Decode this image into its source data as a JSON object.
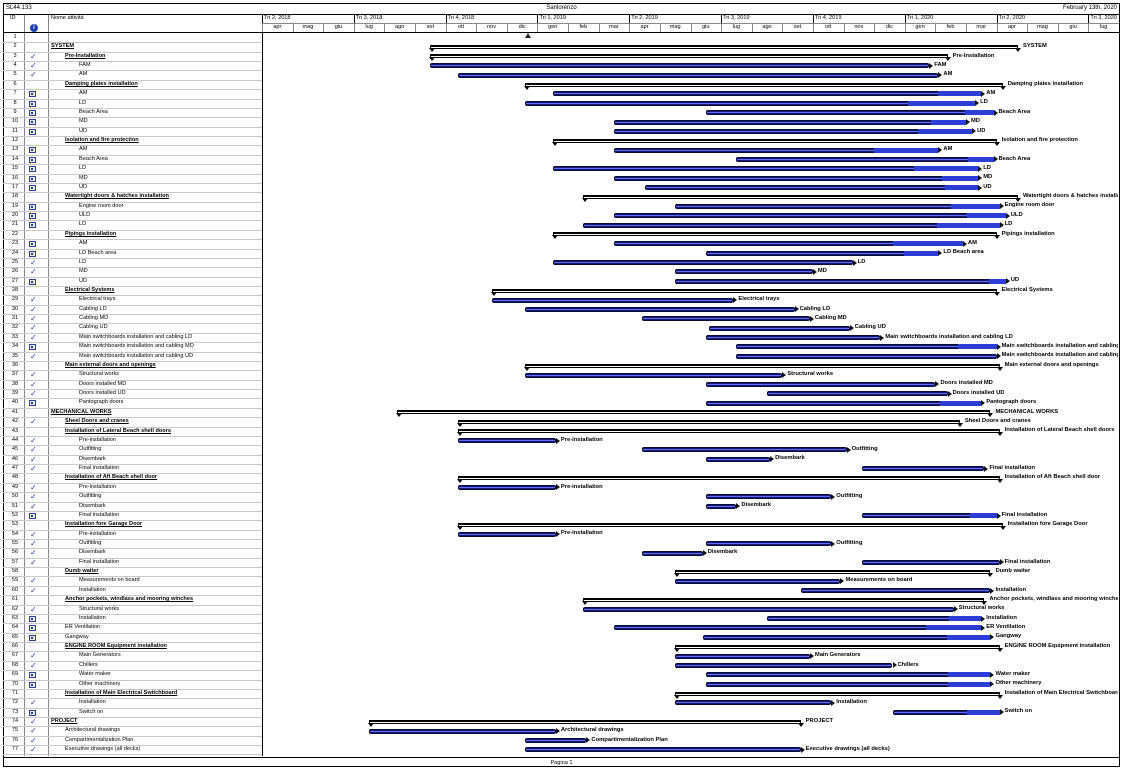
{
  "header": {
    "project_code": "SL44.133",
    "project_name": "Sanlorenzo",
    "date": "February 13th, 2020"
  },
  "columns": {
    "id": "ID",
    "info_icon": "info-icon",
    "name": "Nome attività"
  },
  "timescale": {
    "quarters": [
      "Tri 2, 2018",
      "Tri 3, 2018",
      "Tri 4, 2018",
      "Tri 1, 2019",
      "Tri 2, 2019",
      "Tri 3, 2019",
      "Tri 4, 2019",
      "Tri 1, 2020",
      "Tri 2, 2020",
      "Tri 3, 2020"
    ],
    "months": [
      "apr",
      "mag",
      "giu",
      "lug",
      "ago",
      "set",
      "ott",
      "nov",
      "dic",
      "gen",
      "feb",
      "mar",
      "apr",
      "mag",
      "giu",
      "lug",
      "ago",
      "set",
      "ott",
      "nov",
      "dic",
      "gen",
      "feb",
      "mar",
      "apr",
      "mag",
      "giu",
      "lug"
    ]
  },
  "colors": {
    "progress": "#2b3fd4",
    "summary": "#000000",
    "task": "#1a1a6e",
    "check": "#1f3fa8"
  },
  "tasks": [
    {
      "id": "1",
      "name": "",
      "level": 0,
      "summary": false,
      "ind": "",
      "start": null,
      "end": null,
      "pct": 0,
      "label": ""
    },
    {
      "id": "2",
      "name": "SYSTEM",
      "level": 0,
      "summary": true,
      "ind": "",
      "start": 5.5,
      "end": 24.7,
      "pct": 0,
      "label": "SYSTEM"
    },
    {
      "id": "3",
      "name": "Pre-Installation",
      "level": 1,
      "summary": true,
      "ind": "check",
      "start": 5.5,
      "end": 22.4,
      "pct": 0,
      "label": "Pre-Installation"
    },
    {
      "id": "4",
      "name": "FAM",
      "level": 2,
      "summary": false,
      "ind": "check",
      "start": 5.5,
      "end": 21.8,
      "pct": 0,
      "label": "FAM"
    },
    {
      "id": "5",
      "name": "AM",
      "level": 2,
      "summary": false,
      "ind": "check",
      "start": 6.4,
      "end": 22.1,
      "pct": 0,
      "label": "AM"
    },
    {
      "id": "6",
      "name": "Damping plates installation",
      "level": 1,
      "summary": true,
      "ind": "",
      "start": 8.6,
      "end": 24.2,
      "pct": 0,
      "label": "Damping plates installation"
    },
    {
      "id": "7",
      "name": "AM",
      "level": 2,
      "summary": false,
      "ind": "gantt",
      "start": 9.5,
      "end": 23.5,
      "pct": 0.9,
      "label": "AM"
    },
    {
      "id": "8",
      "name": "LD",
      "level": 2,
      "summary": false,
      "ind": "gantt",
      "start": 8.6,
      "end": 23.3,
      "pct": 0.85,
      "label": "LD"
    },
    {
      "id": "9",
      "name": "Beach Area",
      "level": 2,
      "summary": false,
      "ind": "gantt",
      "start": 14.5,
      "end": 23.9,
      "pct": 0.9,
      "label": "Beach Area"
    },
    {
      "id": "10",
      "name": "MD",
      "level": 2,
      "summary": false,
      "ind": "gantt",
      "start": 11.5,
      "end": 23.0,
      "pct": 0.9,
      "label": "MD"
    },
    {
      "id": "11",
      "name": "UD",
      "level": 2,
      "summary": false,
      "ind": "gantt",
      "start": 11.5,
      "end": 23.2,
      "pct": 0.85,
      "label": "UD"
    },
    {
      "id": "12",
      "name": "Isolation and fire protection",
      "level": 1,
      "summary": true,
      "ind": "",
      "start": 9.5,
      "end": 24.0,
      "pct": 0,
      "label": "Isolation and fire protection"
    },
    {
      "id": "13",
      "name": "AM",
      "level": 2,
      "summary": false,
      "ind": "gantt",
      "start": 11.5,
      "end": 22.1,
      "pct": 0.8,
      "label": "AM"
    },
    {
      "id": "14",
      "name": "Beach Area",
      "level": 2,
      "summary": false,
      "ind": "gantt",
      "start": 15.5,
      "end": 23.9,
      "pct": 0.9,
      "label": "Beach Area"
    },
    {
      "id": "15",
      "name": "LD",
      "level": 2,
      "summary": false,
      "ind": "gantt",
      "start": 9.5,
      "end": 23.4,
      "pct": 0.85,
      "label": "LD"
    },
    {
      "id": "16",
      "name": "MD",
      "level": 2,
      "summary": false,
      "ind": "gantt",
      "start": 11.5,
      "end": 23.4,
      "pct": 0.9,
      "label": "MD"
    },
    {
      "id": "17",
      "name": "UD",
      "level": 2,
      "summary": false,
      "ind": "gantt",
      "start": 12.5,
      "end": 23.4,
      "pct": 0.9,
      "label": "UD"
    },
    {
      "id": "18",
      "name": "Watertight doors & hatches installation",
      "level": 1,
      "summary": true,
      "ind": "",
      "start": 10.5,
      "end": 24.7,
      "pct": 0,
      "label": "Watertight doors & hatches installat"
    },
    {
      "id": "19",
      "name": "Engine room door",
      "level": 2,
      "summary": false,
      "ind": "gantt",
      "start": 13.5,
      "end": 24.1,
      "pct": 0.85,
      "label": "Engine room door"
    },
    {
      "id": "20",
      "name": "ULD",
      "level": 2,
      "summary": false,
      "ind": "gantt",
      "start": 11.5,
      "end": 24.3,
      "pct": 0.9,
      "label": "ULD"
    },
    {
      "id": "21",
      "name": "LD",
      "level": 2,
      "summary": false,
      "ind": "gantt",
      "start": 10.5,
      "end": 24.1,
      "pct": 0.85,
      "label": "LD"
    },
    {
      "id": "22",
      "name": "Pipings installation",
      "level": 1,
      "summary": true,
      "ind": "",
      "start": 9.5,
      "end": 24.0,
      "pct": 0,
      "label": "Pipings installation"
    },
    {
      "id": "23",
      "name": "AM",
      "level": 2,
      "summary": false,
      "ind": "gantt",
      "start": 11.5,
      "end": 22.9,
      "pct": 0.8,
      "label": "AM"
    },
    {
      "id": "24",
      "name": "LD Beach area",
      "level": 2,
      "summary": false,
      "ind": "gantt",
      "start": 14.5,
      "end": 22.1,
      "pct": 0.85,
      "label": "LD Beach area"
    },
    {
      "id": "25",
      "name": "LD",
      "level": 2,
      "summary": false,
      "ind": "check",
      "start": 9.5,
      "end": 19.3,
      "pct": 0,
      "label": "LD"
    },
    {
      "id": "26",
      "name": "MD",
      "level": 2,
      "summary": false,
      "ind": "check",
      "start": 13.5,
      "end": 18.0,
      "pct": 0,
      "label": "MD"
    },
    {
      "id": "27",
      "name": "UD",
      "level": 2,
      "summary": false,
      "ind": "gantt",
      "start": 13.5,
      "end": 24.3,
      "pct": 0.95,
      "label": "UD"
    },
    {
      "id": "28",
      "name": "Electrical Systems",
      "level": 1,
      "summary": true,
      "ind": "",
      "start": 7.5,
      "end": 24.0,
      "pct": 0,
      "label": "Electrical Systems"
    },
    {
      "id": "29",
      "name": "Electrical trays",
      "level": 2,
      "summary": false,
      "ind": "check",
      "start": 7.5,
      "end": 15.4,
      "pct": 0,
      "label": "Electrical trays"
    },
    {
      "id": "30",
      "name": "Cabling LD",
      "level": 2,
      "summary": false,
      "ind": "check",
      "start": 8.6,
      "end": 17.4,
      "pct": 0,
      "label": "Cabling LD"
    },
    {
      "id": "31",
      "name": "Cabling MD",
      "level": 2,
      "summary": false,
      "ind": "check",
      "start": 12.4,
      "end": 17.9,
      "pct": 0,
      "label": "Cabling MD"
    },
    {
      "id": "32",
      "name": "Cabling UD",
      "level": 2,
      "summary": false,
      "ind": "check",
      "start": 14.6,
      "end": 19.2,
      "pct": 0,
      "label": "Cabling UD"
    },
    {
      "id": "33",
      "name": "Main switchboards installation and cabling LD",
      "level": 2,
      "summary": false,
      "ind": "check",
      "start": 14.5,
      "end": 20.2,
      "pct": 0,
      "label": "Main switchboards installation and cabling LD"
    },
    {
      "id": "34",
      "name": "Main switchboards installation and cabling MD",
      "level": 2,
      "summary": false,
      "ind": "gantt",
      "start": 15.5,
      "end": 24.0,
      "pct": 0.85,
      "label": "Main switchboards installation and cabling MD"
    },
    {
      "id": "35",
      "name": "Main switchboards installation and cabling UD",
      "level": 2,
      "summary": false,
      "ind": "check",
      "start": 15.5,
      "end": 24.0,
      "pct": 0,
      "label": "Main switchboards installation and cabling"
    },
    {
      "id": "36",
      "name": "Main external doors and openings",
      "level": 1,
      "summary": true,
      "ind": "",
      "start": 8.6,
      "end": 24.1,
      "pct": 0,
      "label": "Main external doors and openings"
    },
    {
      "id": "37",
      "name": "Structural works",
      "level": 2,
      "summary": false,
      "ind": "check",
      "start": 8.6,
      "end": 17.0,
      "pct": 0,
      "label": "Structural works"
    },
    {
      "id": "38",
      "name": "Doors installed MD",
      "level": 2,
      "summary": false,
      "ind": "check",
      "start": 14.5,
      "end": 22.0,
      "pct": 0,
      "label": "Doors installed MD"
    },
    {
      "id": "39",
      "name": "Doors installed UD",
      "level": 2,
      "summary": false,
      "ind": "check",
      "start": 16.5,
      "end": 22.4,
      "pct": 0,
      "label": "Doors installed UD"
    },
    {
      "id": "40",
      "name": "Pantograph doors",
      "level": 2,
      "summary": false,
      "ind": "gantt",
      "start": 14.5,
      "end": 23.5,
      "pct": 0.85,
      "label": "Pantograph doors"
    },
    {
      "id": "41",
      "name": "MECHANICAL WORKS",
      "level": 0,
      "summary": true,
      "ind": "",
      "start": 4.4,
      "end": 23.8,
      "pct": 0,
      "label": "MECHANICAL WORKS"
    },
    {
      "id": "42",
      "name": "Sheel Doors and cranes",
      "level": 1,
      "summary": true,
      "ind": "check",
      "start": 6.4,
      "end": 22.8,
      "pct": 0,
      "label": "Sheel Doors and cranes"
    },
    {
      "id": "43",
      "name": "Installation of Lateral Beach shell doors",
      "level": 1,
      "summary": true,
      "ind": "",
      "start": 6.4,
      "end": 24.1,
      "pct": 0,
      "label": "Installation of Lateral Beach shell doors"
    },
    {
      "id": "44",
      "name": "Pre-installation",
      "level": 2,
      "summary": false,
      "ind": "check",
      "start": 6.4,
      "end": 9.6,
      "pct": 0,
      "label": "Pre-installation"
    },
    {
      "id": "45",
      "name": "Outfitting",
      "level": 2,
      "summary": false,
      "ind": "check",
      "start": 12.4,
      "end": 19.1,
      "pct": 0,
      "label": "Outfitting"
    },
    {
      "id": "46",
      "name": "Disembark",
      "level": 2,
      "summary": false,
      "ind": "check",
      "start": 14.5,
      "end": 16.6,
      "pct": 0,
      "label": "Disembark"
    },
    {
      "id": "47",
      "name": "Final installation",
      "level": 2,
      "summary": false,
      "ind": "check",
      "start": 19.6,
      "end": 23.6,
      "pct": 0,
      "label": "Final installation"
    },
    {
      "id": "48",
      "name": "Installation of Aft Beach shell door",
      "level": 1,
      "summary": true,
      "ind": "",
      "start": 6.4,
      "end": 24.1,
      "pct": 0,
      "label": "Installation of Aft Beach shell door"
    },
    {
      "id": "49",
      "name": "Pre-installation",
      "level": 2,
      "summary": false,
      "ind": "check",
      "start": 6.4,
      "end": 9.6,
      "pct": 0,
      "label": "Pre-installation"
    },
    {
      "id": "50",
      "name": "Outfitting",
      "level": 2,
      "summary": false,
      "ind": "check",
      "start": 14.5,
      "end": 18.6,
      "pct": 0,
      "label": "Outfitting"
    },
    {
      "id": "51",
      "name": "Disembark",
      "level": 2,
      "summary": false,
      "ind": "check",
      "start": 14.5,
      "end": 15.5,
      "pct": 0,
      "label": "Disembark"
    },
    {
      "id": "52",
      "name": "Final installation",
      "level": 2,
      "summary": false,
      "ind": "gantt",
      "start": 19.6,
      "end": 24.0,
      "pct": 0.8,
      "label": "Final installation"
    },
    {
      "id": "53",
      "name": "Installation fore Garage Door",
      "level": 1,
      "summary": true,
      "ind": "",
      "start": 6.4,
      "end": 24.2,
      "pct": 0,
      "label": "Installation fore Garage Door"
    },
    {
      "id": "54",
      "name": "Pre-installation",
      "level": 2,
      "summary": false,
      "ind": "check",
      "start": 6.4,
      "end": 9.6,
      "pct": 0,
      "label": "Pre-installation"
    },
    {
      "id": "55",
      "name": "Outfitting",
      "level": 2,
      "summary": false,
      "ind": "check",
      "start": 14.5,
      "end": 18.6,
      "pct": 0,
      "label": "Outfitting"
    },
    {
      "id": "56",
      "name": "Disembark",
      "level": 2,
      "summary": false,
      "ind": "check",
      "start": 12.4,
      "end": 14.4,
      "pct": 0,
      "label": "Disembark"
    },
    {
      "id": "57",
      "name": "Final installation",
      "level": 2,
      "summary": false,
      "ind": "check",
      "start": 19.6,
      "end": 24.1,
      "pct": 0,
      "label": "Final installation"
    },
    {
      "id": "58",
      "name": "Dumb waiter",
      "level": 1,
      "summary": true,
      "ind": "",
      "start": 13.5,
      "end": 23.8,
      "pct": 0,
      "label": "Dumb waiter"
    },
    {
      "id": "59",
      "name": "Measurements on board",
      "level": 2,
      "summary": false,
      "ind": "check",
      "start": 13.5,
      "end": 18.9,
      "pct": 0,
      "label": "Measurements on board"
    },
    {
      "id": "60",
      "name": "Installation",
      "level": 2,
      "summary": false,
      "ind": "check",
      "start": 17.6,
      "end": 23.8,
      "pct": 0,
      "label": "Installation"
    },
    {
      "id": "61",
      "name": "Anchor pockets, windlass and mooring winches",
      "level": 1,
      "summary": true,
      "ind": "",
      "start": 10.5,
      "end": 23.6,
      "pct": 0,
      "label": "Anchor pockets, windlass and mooring winches"
    },
    {
      "id": "62",
      "name": "Structural works",
      "level": 2,
      "summary": false,
      "ind": "check",
      "start": 10.5,
      "end": 22.6,
      "pct": 0,
      "label": "Structural works"
    },
    {
      "id": "63",
      "name": "Installation",
      "level": 2,
      "summary": false,
      "ind": "gantt",
      "start": 16.5,
      "end": 23.5,
      "pct": 0.85,
      "label": "Installation"
    },
    {
      "id": "64",
      "name": "ER Ventilation",
      "level": 1,
      "summary": false,
      "ind": "gantt",
      "start": 11.5,
      "end": 23.5,
      "pct": 0.85,
      "label": "ER Ventilation"
    },
    {
      "id": "65",
      "name": "Gangway",
      "level": 1,
      "summary": false,
      "ind": "gantt",
      "start": 14.4,
      "end": 23.8,
      "pct": 0.85,
      "label": "Gangway"
    },
    {
      "id": "66",
      "name": "ENGINE ROOM Equipment installation",
      "level": 1,
      "summary": true,
      "ind": "",
      "start": 13.5,
      "end": 24.1,
      "pct": 0,
      "label": "ENGINE ROOM Equipment installation"
    },
    {
      "id": "67",
      "name": "Main Generators",
      "level": 2,
      "summary": false,
      "ind": "check",
      "start": 13.5,
      "end": 17.9,
      "pct": 0,
      "label": "Main Generators"
    },
    {
      "id": "68",
      "name": "Chillers",
      "level": 2,
      "summary": false,
      "ind": "check",
      "start": 13.5,
      "end": 20.6,
      "pct": 0,
      "label": "Chillers"
    },
    {
      "id": "69",
      "name": "Water maker",
      "level": 2,
      "summary": false,
      "ind": "gantt",
      "start": 14.5,
      "end": 23.8,
      "pct": 0.85,
      "label": "Water maker"
    },
    {
      "id": "70",
      "name": "Other machinery",
      "level": 2,
      "summary": false,
      "ind": "gantt",
      "start": 14.5,
      "end": 23.8,
      "pct": 0.85,
      "label": "Other machinery"
    },
    {
      "id": "71",
      "name": "Installation of Main Electrical Switchboard",
      "level": 1,
      "summary": true,
      "ind": "",
      "start": 13.5,
      "end": 24.1,
      "pct": 0,
      "label": "Installation of Main Electrical Switchboard"
    },
    {
      "id": "72",
      "name": "Installation",
      "level": 2,
      "summary": false,
      "ind": "check",
      "start": 13.5,
      "end": 18.6,
      "pct": 0,
      "label": "Installation"
    },
    {
      "id": "73",
      "name": "Switch on",
      "level": 2,
      "summary": false,
      "ind": "gantt",
      "start": 20.6,
      "end": 24.1,
      "pct": 0.7,
      "label": "Switch on"
    },
    {
      "id": "74",
      "name": "PROJECT",
      "level": 0,
      "summary": true,
      "ind": "check",
      "start": 3.5,
      "end": 17.6,
      "pct": 0,
      "label": "PROJECT"
    },
    {
      "id": "75",
      "name": "Architectural drawings",
      "level": 1,
      "summary": false,
      "ind": "check",
      "start": 3.5,
      "end": 9.6,
      "pct": 0,
      "label": "Architectural drawings"
    },
    {
      "id": "76",
      "name": "Compartimentalization Plan",
      "level": 1,
      "summary": false,
      "ind": "check",
      "start": 8.6,
      "end": 10.6,
      "pct": 0,
      "label": "Compartimentalization Plan"
    },
    {
      "id": "77",
      "name": "Executive drawings (all decks)",
      "level": 1,
      "summary": false,
      "ind": "check",
      "start": 8.6,
      "end": 17.6,
      "pct": 0,
      "label": "Executive drawings (all decks)"
    }
  ],
  "footer": {
    "page": "Pagina 1"
  }
}
